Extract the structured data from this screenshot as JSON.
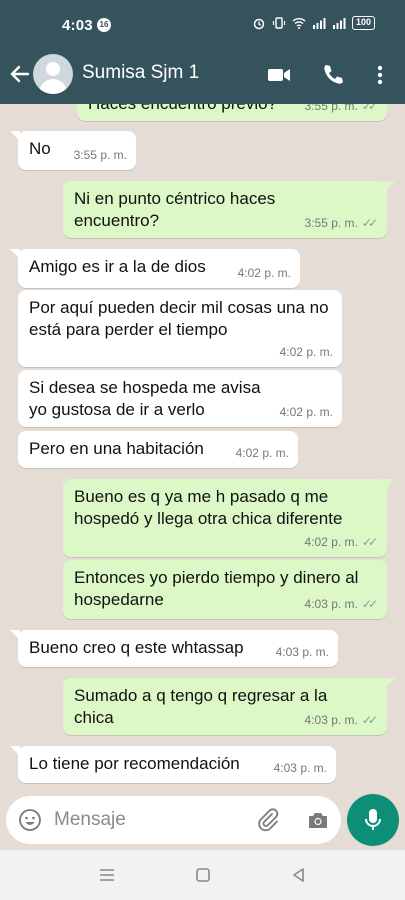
{
  "status_bar": {
    "time": "4:03",
    "notification_count": "16",
    "battery": "100"
  },
  "header": {
    "contact_name": "Sumisa Sjm 1"
  },
  "messages": [
    {
      "dir": "out",
      "text": "Haces encuentro previo?",
      "time": "3:55 p. m."
    },
    {
      "dir": "in",
      "text": "No",
      "time": "3:55 p. m."
    },
    {
      "dir": "out",
      "text": "Ni en punto céntrico haces encuentro?",
      "time": "3:55 p. m."
    },
    {
      "dir": "in",
      "text": "Amigo es ir a la de dios",
      "time": "4:02 p. m."
    },
    {
      "dir": "in",
      "text": "Por aquí pueden decir mil cosas una no está para perder el tiempo",
      "time": "4:02 p. m."
    },
    {
      "dir": "in",
      "text": "Si desea se hospeda me avisa yo gustosa de ir a verlo",
      "time": "4:02 p. m."
    },
    {
      "dir": "in",
      "text": "Pero en una habitación",
      "time": "4:02 p. m."
    },
    {
      "dir": "out",
      "text": "Bueno es q ya me h pasado q me hospedó y llega otra chica diferente",
      "time": "4:02 p. m."
    },
    {
      "dir": "out",
      "text": "Entonces yo pierdo tiempo y dinero al hospedarne",
      "time": "4:03 p. m."
    },
    {
      "dir": "in",
      "text": "Bueno creo q este whtassap",
      "time": "4:03 p. m."
    },
    {
      "dir": "out",
      "text": "Sumado a q tengo q regresar a la chica",
      "time": "4:03 p. m."
    },
    {
      "dir": "in",
      "text": "Lo tiene por recomendación",
      "time": "4:03 p. m."
    }
  ],
  "input": {
    "placeholder": "Mensaje"
  },
  "colors": {
    "header": "#35535c",
    "incoming": "#ffffff",
    "outgoing": "#dcf8c6",
    "chat_bg": "#e5ddd5",
    "mic": "#0d8f77"
  }
}
